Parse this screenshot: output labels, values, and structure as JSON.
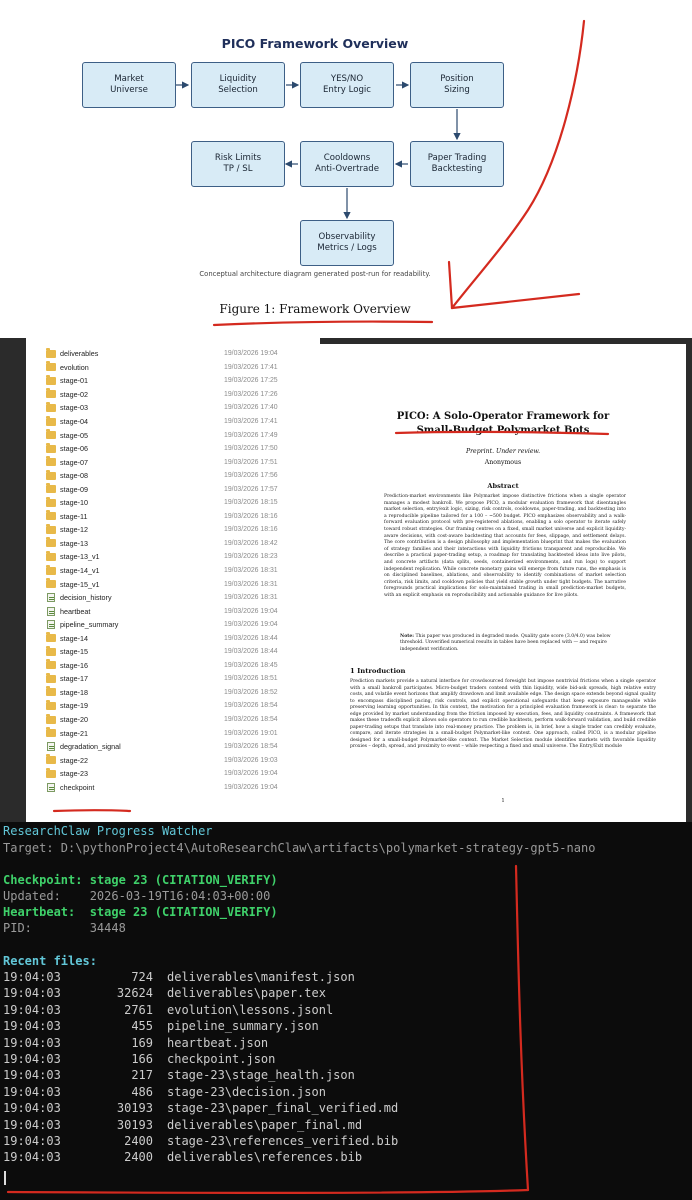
{
  "diagram": {
    "title": "PICO Framework Overview",
    "boxes": [
      {
        "label": "Market\nUniverse"
      },
      {
        "label": "Liquidity\nSelection"
      },
      {
        "label": "YES/NO\nEntry Logic"
      },
      {
        "label": "Position\nSizing"
      },
      {
        "label": "Paper Trading\nBacktesting"
      },
      {
        "label": "Cooldowns\nAnti-Overtrade"
      },
      {
        "label": "Risk Limits\nTP / SL"
      },
      {
        "label": "Observability\nMetrics / Logs"
      }
    ],
    "caption": "Conceptual architecture diagram generated post-run for readability.",
    "figure_caption": "Figure 1: Framework Overview"
  },
  "explorer": {
    "files": [
      {
        "name": "deliverables",
        "date": "19/03/2026 19:04",
        "type": "folder"
      },
      {
        "name": "evolution",
        "date": "19/03/2026 17:41",
        "type": "folder"
      },
      {
        "name": "stage-01",
        "date": "19/03/2026 17:25",
        "type": "folder"
      },
      {
        "name": "stage-02",
        "date": "19/03/2026 17:26",
        "type": "folder"
      },
      {
        "name": "stage-03",
        "date": "19/03/2026 17:40",
        "type": "folder"
      },
      {
        "name": "stage-04",
        "date": "19/03/2026 17:41",
        "type": "folder"
      },
      {
        "name": "stage-05",
        "date": "19/03/2026 17:49",
        "type": "folder"
      },
      {
        "name": "stage-06",
        "date": "19/03/2026 17:50",
        "type": "folder"
      },
      {
        "name": "stage-07",
        "date": "19/03/2026 17:51",
        "type": "folder"
      },
      {
        "name": "stage-08",
        "date": "19/03/2026 17:56",
        "type": "folder"
      },
      {
        "name": "stage-09",
        "date": "19/03/2026 17:57",
        "type": "folder"
      },
      {
        "name": "stage-10",
        "date": "19/03/2026 18:15",
        "type": "folder"
      },
      {
        "name": "stage-11",
        "date": "19/03/2026 18:16",
        "type": "folder"
      },
      {
        "name": "stage-12",
        "date": "19/03/2026 18:16",
        "type": "folder"
      },
      {
        "name": "stage-13",
        "date": "19/03/2026 18:42",
        "type": "folder"
      },
      {
        "name": "stage-13_v1",
        "date": "19/03/2026 18:23",
        "type": "folder"
      },
      {
        "name": "stage-14_v1",
        "date": "19/03/2026 18:31",
        "type": "folder"
      },
      {
        "name": "stage-15_v1",
        "date": "19/03/2026 18:31",
        "type": "folder"
      },
      {
        "name": "decision_history",
        "date": "19/03/2026 18:31",
        "type": "file"
      },
      {
        "name": "heartbeat",
        "date": "19/03/2026 19:04",
        "type": "file"
      },
      {
        "name": "pipeline_summary",
        "date": "19/03/2026 19:04",
        "type": "file"
      },
      {
        "name": "stage-14",
        "date": "19/03/2026 18:44",
        "type": "folder"
      },
      {
        "name": "stage-15",
        "date": "19/03/2026 18:44",
        "type": "folder"
      },
      {
        "name": "stage-16",
        "date": "19/03/2026 18:45",
        "type": "folder"
      },
      {
        "name": "stage-17",
        "date": "19/03/2026 18:51",
        "type": "folder"
      },
      {
        "name": "stage-18",
        "date": "19/03/2026 18:52",
        "type": "folder"
      },
      {
        "name": "stage-19",
        "date": "19/03/2026 18:54",
        "type": "folder"
      },
      {
        "name": "stage-20",
        "date": "19/03/2026 18:54",
        "type": "folder"
      },
      {
        "name": "stage-21",
        "date": "19/03/2026 19:01",
        "type": "folder"
      },
      {
        "name": "degradation_signal",
        "date": "19/03/2026 18:54",
        "type": "file"
      },
      {
        "name": "stage-22",
        "date": "19/03/2026 19:03",
        "type": "folder"
      },
      {
        "name": "stage-23",
        "date": "19/03/2026 19:04",
        "type": "folder"
      },
      {
        "name": "checkpoint",
        "date": "19/03/2026 19:04",
        "type": "file"
      }
    ]
  },
  "paper": {
    "title": "PICO: A Solo-Operator Framework for\nSmall-Budget Polymarket Bots",
    "preprint": "Preprint. Under review.",
    "author": "Anonymous",
    "abstract_heading": "Abstract",
    "abstract": "Prediction-market environments like Polymarket impose distinctive frictions when a single operator manages a modest bankroll. We propose PICO, a modular evaluation framework that disentangles market selection, entry/exit logic, sizing, risk controls, cooldowns, paper-trading, and backtesting into a reproducible pipeline tailored for a 100 – ~500 budget. PICO emphasizes observability and a walk-forward evaluation protocol with pre-registered ablations, enabling a solo operator to iterate safely toward robust strategies. Our framing centres on a fixed, small market universe and explicit liquidity-aware decisions, with cost-aware backtesting that accounts for fees, slippage, and settlement delays. The core contribution is a design philosophy and implementation blueprint that makes the evaluation of strategy families and their interactions with liquidity frictions transparent and reproducible. We describe a practical paper-trading setup, a roadmap for translating backtested ideas into live pilots, and concrete artifacts (data splits, seeds, containerized environments, and run logs) to support independent replication. While concrete monetary gains will emerge from future runs, the emphasis is on disciplined baselines, ablations, and observability to identify combinations of market selection criteria, risk limits, and cooldown policies that yield stable growth under tight budgets. The narrative foregrounds practical implications for solo-maintained trading in small prediction-market budgets, with an explicit emphasis on reproducibility and actionable guidance for live pilots.",
    "note_label": "Note:",
    "note": "This paper was produced in degraded mode. Quality gate score (3.0/4.0) was below threshold. Unverified numerical results in tables have been replaced with — and require independent verification.",
    "section_heading": "1   Introduction",
    "intro": "Prediction markets provide a natural interface for crowdsourced foresight but impose nontrivial frictions when a single operator with a small bankroll participates. Micro-budget traders contend with thin liquidity, wide bid-ask spreads, high relative entry costs, and volatile event horizons that amplify drawdown and limit available edge. The design space extends beyond signal quality to encompass disciplined pacing, risk controls, and explicit operational safeguards that keep exposure manageable while preserving learning opportunities. In this context, the motivation for a principled evaluation framework is clear: to separate the edge provided by market understanding from the friction imposed by execution, fees, and liquidity constraints. A framework that makes these tradeoffs explicit allows solo operators to run credible backtests, perform walk-forward validation, and build credible paper-trading setups that translate into real-money practice. The problem is, in brief, how a single trader can credibly evaluate, compare, and iterate strategies in a small-budget Polymarket-like context. One approach, called PICO, is a modular pipeline designed for a small-budget Polymarket-like context. The Market Selection module identifies markets with favorable liquidity proxies – depth, spread, and proximity to event – while respecting a fixed and small universe. The Entry/Exit module",
    "page_number": "1"
  },
  "terminal": {
    "title": "ResearchClaw Progress Watcher",
    "target": "Target: D:\\pythonProject4\\AutoResearchClaw\\artifacts\\polymarket-strategy-gpt5-nano",
    "checkpoint_label": "Checkpoint:",
    "checkpoint_value": "stage 23 (CITATION_VERIFY)",
    "updated_label": "Updated:",
    "updated_value": "2026-03-19T16:04:03+00:00",
    "heartbeat_label": "Heartbeat:",
    "heartbeat_value": "stage 23 (CITATION_VERIFY)",
    "pid_label": "PID:",
    "pid_value": "34448",
    "recent_files_label": "Recent files:",
    "recent_files": [
      {
        "time": "19:04:03",
        "size": "724",
        "path": "deliverables\\manifest.json"
      },
      {
        "time": "19:04:03",
        "size": "32624",
        "path": "deliverables\\paper.tex"
      },
      {
        "time": "19:04:03",
        "size": "2761",
        "path": "evolution\\lessons.jsonl"
      },
      {
        "time": "19:04:03",
        "size": "455",
        "path": "pipeline_summary.json"
      },
      {
        "time": "19:04:03",
        "size": "169",
        "path": "heartbeat.json"
      },
      {
        "time": "19:04:03",
        "size": "166",
        "path": "checkpoint.json"
      },
      {
        "time": "19:04:03",
        "size": "217",
        "path": "stage-23\\stage_health.json"
      },
      {
        "time": "19:04:03",
        "size": "486",
        "path": "stage-23\\decision.json"
      },
      {
        "time": "19:04:03",
        "size": "30193",
        "path": "stage-23\\paper_final_verified.md"
      },
      {
        "time": "19:04:03",
        "size": "30193",
        "path": "deliverables\\paper_final.md"
      },
      {
        "time": "19:04:03",
        "size": "2400",
        "path": "stage-23\\references_verified.bib"
      },
      {
        "time": "19:04:03",
        "size": "2400",
        "path": "deliverables\\references.bib"
      }
    ]
  },
  "colors": {
    "box_fill": "#d8ebf6",
    "box_border": "#3d5f86",
    "annotation_red": "#d42a1f",
    "terminal_cyan": "#62c7d8",
    "terminal_green": "#3fd16a"
  }
}
